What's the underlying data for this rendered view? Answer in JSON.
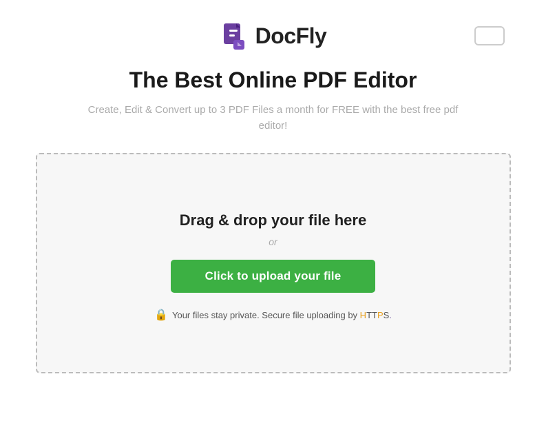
{
  "header": {
    "logo_text": "DocFly",
    "top_right_button_label": ""
  },
  "hero": {
    "headline": "The Best Online PDF Editor",
    "subheadline": "Create, Edit & Convert up to 3 PDF Files a month for FREE with the best free pdf editor!"
  },
  "dropzone": {
    "drag_drop_label": "Drag & drop your file here",
    "or_label": "or",
    "upload_button_label": "Click to upload your file",
    "security_label_prefix": "Your files stay private. Secure file uploading by ",
    "security_https": "HTTPS.",
    "lock_icon": "🔒"
  }
}
